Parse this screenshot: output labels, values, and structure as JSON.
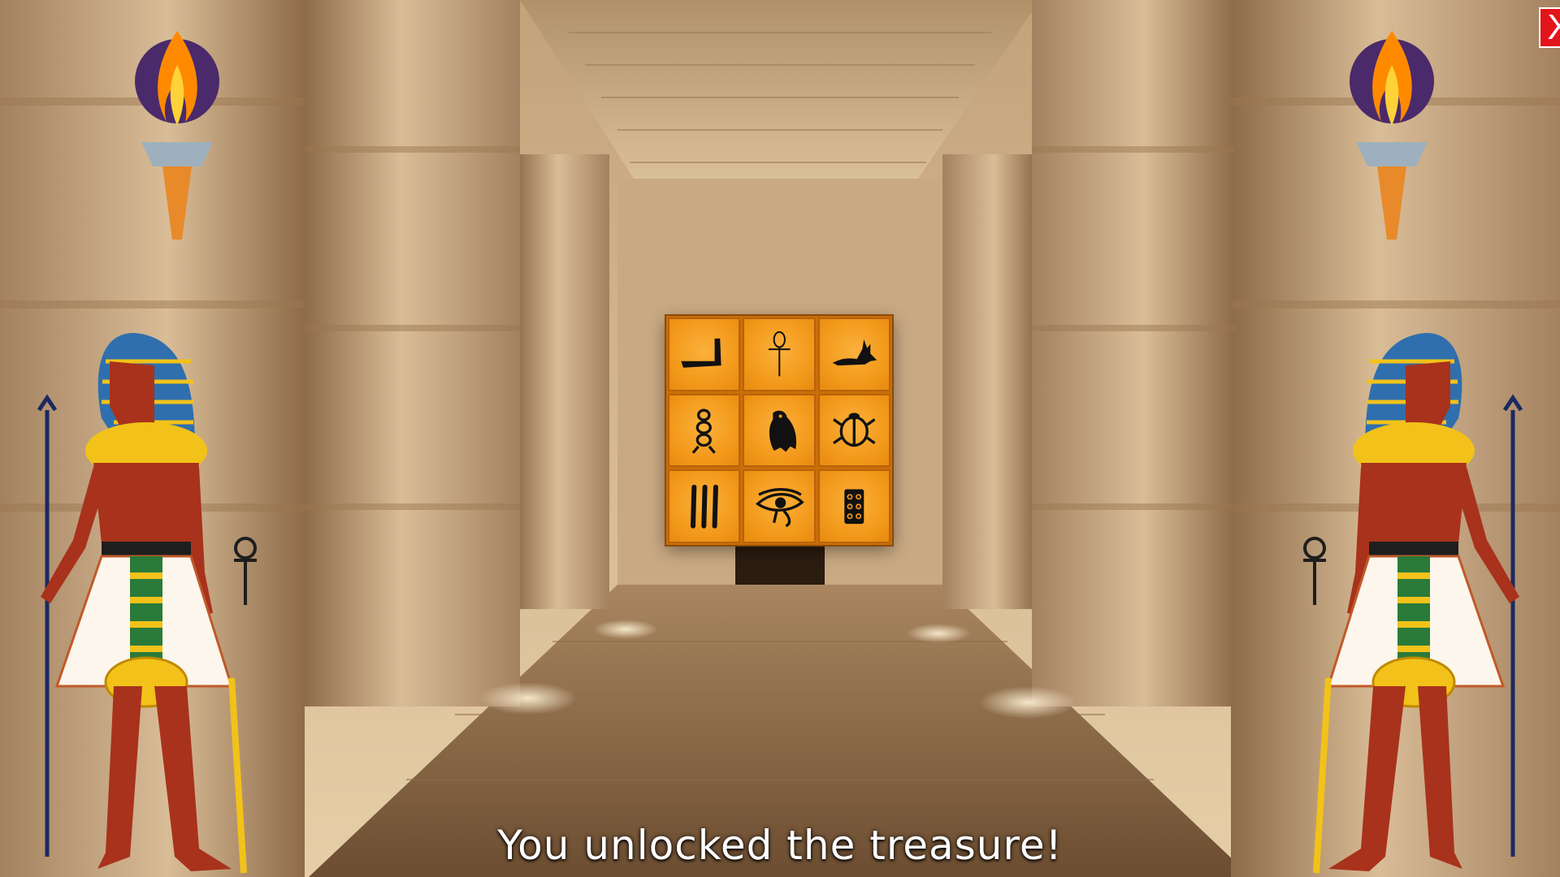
{
  "game": {
    "close_label": "X",
    "message": "You unlocked the treasure!",
    "close_color": "#e4141b",
    "tile_color": "#f39a1c"
  },
  "puzzle": {
    "tiles": [
      {
        "icon": "arm-hieroglyph-icon"
      },
      {
        "icon": "ankh-icon"
      },
      {
        "icon": "jackal-icon"
      },
      {
        "icon": "rope-coil-icon"
      },
      {
        "icon": "owl-icon"
      },
      {
        "icon": "scarab-icon"
      },
      {
        "icon": "three-strokes-icon"
      },
      {
        "icon": "eye-of-horus-icon"
      },
      {
        "icon": "six-dots-icon"
      }
    ]
  }
}
